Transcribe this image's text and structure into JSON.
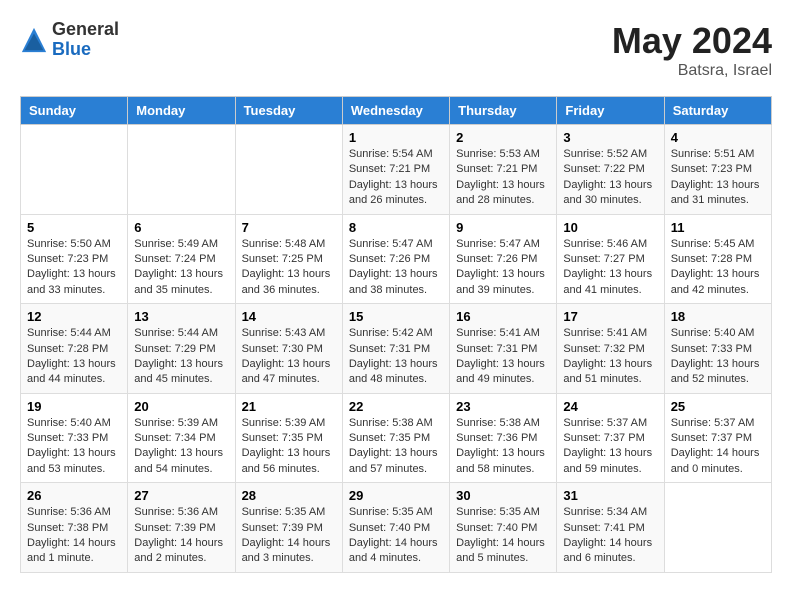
{
  "logo": {
    "general": "General",
    "blue": "Blue"
  },
  "header": {
    "month_year": "May 2024",
    "location": "Batsra, Israel"
  },
  "days_of_week": [
    "Sunday",
    "Monday",
    "Tuesday",
    "Wednesday",
    "Thursday",
    "Friday",
    "Saturday"
  ],
  "weeks": [
    [
      {
        "day": "",
        "info": ""
      },
      {
        "day": "",
        "info": ""
      },
      {
        "day": "",
        "info": ""
      },
      {
        "day": "1",
        "sunrise": "Sunrise: 5:54 AM",
        "sunset": "Sunset: 7:21 PM",
        "daylight": "Daylight: 13 hours and 26 minutes."
      },
      {
        "day": "2",
        "sunrise": "Sunrise: 5:53 AM",
        "sunset": "Sunset: 7:21 PM",
        "daylight": "Daylight: 13 hours and 28 minutes."
      },
      {
        "day": "3",
        "sunrise": "Sunrise: 5:52 AM",
        "sunset": "Sunset: 7:22 PM",
        "daylight": "Daylight: 13 hours and 30 minutes."
      },
      {
        "day": "4",
        "sunrise": "Sunrise: 5:51 AM",
        "sunset": "Sunset: 7:23 PM",
        "daylight": "Daylight: 13 hours and 31 minutes."
      }
    ],
    [
      {
        "day": "5",
        "sunrise": "Sunrise: 5:50 AM",
        "sunset": "Sunset: 7:23 PM",
        "daylight": "Daylight: 13 hours and 33 minutes."
      },
      {
        "day": "6",
        "sunrise": "Sunrise: 5:49 AM",
        "sunset": "Sunset: 7:24 PM",
        "daylight": "Daylight: 13 hours and 35 minutes."
      },
      {
        "day": "7",
        "sunrise": "Sunrise: 5:48 AM",
        "sunset": "Sunset: 7:25 PM",
        "daylight": "Daylight: 13 hours and 36 minutes."
      },
      {
        "day": "8",
        "sunrise": "Sunrise: 5:47 AM",
        "sunset": "Sunset: 7:26 PM",
        "daylight": "Daylight: 13 hours and 38 minutes."
      },
      {
        "day": "9",
        "sunrise": "Sunrise: 5:47 AM",
        "sunset": "Sunset: 7:26 PM",
        "daylight": "Daylight: 13 hours and 39 minutes."
      },
      {
        "day": "10",
        "sunrise": "Sunrise: 5:46 AM",
        "sunset": "Sunset: 7:27 PM",
        "daylight": "Daylight: 13 hours and 41 minutes."
      },
      {
        "day": "11",
        "sunrise": "Sunrise: 5:45 AM",
        "sunset": "Sunset: 7:28 PM",
        "daylight": "Daylight: 13 hours and 42 minutes."
      }
    ],
    [
      {
        "day": "12",
        "sunrise": "Sunrise: 5:44 AM",
        "sunset": "Sunset: 7:28 PM",
        "daylight": "Daylight: 13 hours and 44 minutes."
      },
      {
        "day": "13",
        "sunrise": "Sunrise: 5:44 AM",
        "sunset": "Sunset: 7:29 PM",
        "daylight": "Daylight: 13 hours and 45 minutes."
      },
      {
        "day": "14",
        "sunrise": "Sunrise: 5:43 AM",
        "sunset": "Sunset: 7:30 PM",
        "daylight": "Daylight: 13 hours and 47 minutes."
      },
      {
        "day": "15",
        "sunrise": "Sunrise: 5:42 AM",
        "sunset": "Sunset: 7:31 PM",
        "daylight": "Daylight: 13 hours and 48 minutes."
      },
      {
        "day": "16",
        "sunrise": "Sunrise: 5:41 AM",
        "sunset": "Sunset: 7:31 PM",
        "daylight": "Daylight: 13 hours and 49 minutes."
      },
      {
        "day": "17",
        "sunrise": "Sunrise: 5:41 AM",
        "sunset": "Sunset: 7:32 PM",
        "daylight": "Daylight: 13 hours and 51 minutes."
      },
      {
        "day": "18",
        "sunrise": "Sunrise: 5:40 AM",
        "sunset": "Sunset: 7:33 PM",
        "daylight": "Daylight: 13 hours and 52 minutes."
      }
    ],
    [
      {
        "day": "19",
        "sunrise": "Sunrise: 5:40 AM",
        "sunset": "Sunset: 7:33 PM",
        "daylight": "Daylight: 13 hours and 53 minutes."
      },
      {
        "day": "20",
        "sunrise": "Sunrise: 5:39 AM",
        "sunset": "Sunset: 7:34 PM",
        "daylight": "Daylight: 13 hours and 54 minutes."
      },
      {
        "day": "21",
        "sunrise": "Sunrise: 5:39 AM",
        "sunset": "Sunset: 7:35 PM",
        "daylight": "Daylight: 13 hours and 56 minutes."
      },
      {
        "day": "22",
        "sunrise": "Sunrise: 5:38 AM",
        "sunset": "Sunset: 7:35 PM",
        "daylight": "Daylight: 13 hours and 57 minutes."
      },
      {
        "day": "23",
        "sunrise": "Sunrise: 5:38 AM",
        "sunset": "Sunset: 7:36 PM",
        "daylight": "Daylight: 13 hours and 58 minutes."
      },
      {
        "day": "24",
        "sunrise": "Sunrise: 5:37 AM",
        "sunset": "Sunset: 7:37 PM",
        "daylight": "Daylight: 13 hours and 59 minutes."
      },
      {
        "day": "25",
        "sunrise": "Sunrise: 5:37 AM",
        "sunset": "Sunset: 7:37 PM",
        "daylight": "Daylight: 14 hours and 0 minutes."
      }
    ],
    [
      {
        "day": "26",
        "sunrise": "Sunrise: 5:36 AM",
        "sunset": "Sunset: 7:38 PM",
        "daylight": "Daylight: 14 hours and 1 minute."
      },
      {
        "day": "27",
        "sunrise": "Sunrise: 5:36 AM",
        "sunset": "Sunset: 7:39 PM",
        "daylight": "Daylight: 14 hours and 2 minutes."
      },
      {
        "day": "28",
        "sunrise": "Sunrise: 5:35 AM",
        "sunset": "Sunset: 7:39 PM",
        "daylight": "Daylight: 14 hours and 3 minutes."
      },
      {
        "day": "29",
        "sunrise": "Sunrise: 5:35 AM",
        "sunset": "Sunset: 7:40 PM",
        "daylight": "Daylight: 14 hours and 4 minutes."
      },
      {
        "day": "30",
        "sunrise": "Sunrise: 5:35 AM",
        "sunset": "Sunset: 7:40 PM",
        "daylight": "Daylight: 14 hours and 5 minutes."
      },
      {
        "day": "31",
        "sunrise": "Sunrise: 5:34 AM",
        "sunset": "Sunset: 7:41 PM",
        "daylight": "Daylight: 14 hours and 6 minutes."
      },
      {
        "day": "",
        "info": ""
      }
    ]
  ]
}
